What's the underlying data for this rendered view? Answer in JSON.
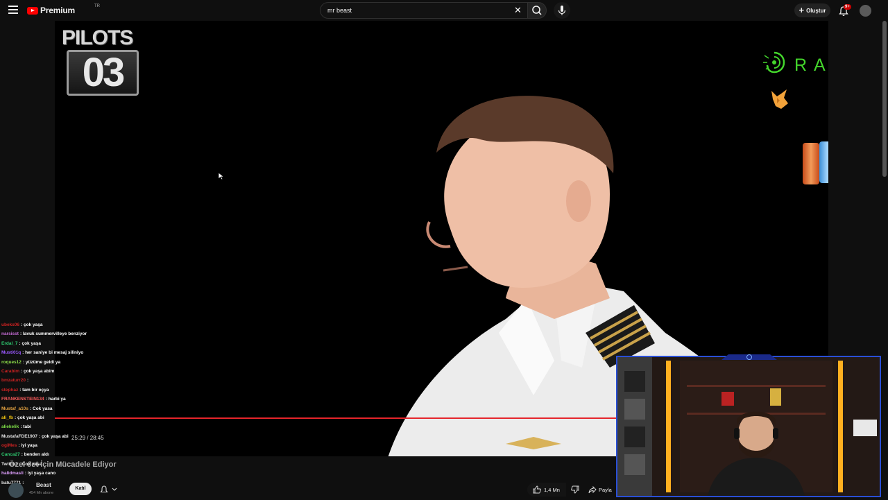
{
  "header": {
    "logo_text": "Premium",
    "logo_sup": "TR",
    "search_value": "mr beast",
    "create_label": "Oluştur",
    "notif_count": "9+"
  },
  "video": {
    "overlay_pilots": "PILOTS",
    "overlay_number": "03",
    "sponsor_text": "RAZER",
    "progress_percent": 90.3,
    "time_display": "25:29 / 28:45",
    "title": "Özel Jet İçin Mücadele Ediyor"
  },
  "chat": [
    {
      "user": "ubeks06",
      "msg": ": çok yaşa",
      "color": "#cc2222"
    },
    {
      "user": "narsisst",
      "msg": ": lavuk summervilleye benziyor",
      "color": "#c86dd7"
    },
    {
      "user": "Erdal_7",
      "msg": ": çok yaşa",
      "color": "#2ecc71"
    },
    {
      "user": "Musti01q",
      "msg": ": her saniye bi mesaj siliniyo",
      "color": "#9b59ff"
    },
    {
      "user": "roques12",
      "msg": ": yüzüme geldi ya",
      "color": "#8fe04a"
    },
    {
      "user": "Carabim",
      "msg": ": çok yaşa abim",
      "color": "#cc2222"
    },
    {
      "user": "bmzaturr20",
      "msg": ":",
      "color": "#cc2222"
    },
    {
      "user": "stephaz",
      "msg": ": tam bir oçya",
      "color": "#cc2222"
    },
    {
      "user": "FRANKENSTEIN134",
      "msg": ": harbi ya",
      "color": "#ff5c5c"
    },
    {
      "user": "Mustaf_a10s",
      "msg": ": Cok yasa",
      "color": "#e0a040"
    },
    {
      "user": "ali_fb",
      "msg": ": çok yaşa abi",
      "color": "#f1c40f"
    },
    {
      "user": "aliekelik",
      "msg": ": tabi",
      "color": "#7fe048"
    },
    {
      "user": "MustafaFDE1907",
      "msg": ": çok yaşa abi",
      "color": "#e0e0e0"
    },
    {
      "user": "ogiMes",
      "msg": ": iyi yaşa",
      "color": "#cc2222"
    },
    {
      "user": "Canca27",
      "msg": ": benden aldı",
      "color": "#2ecc71"
    },
    {
      "user": "Twitch3",
      "msg": ": Çok yaşa",
      "color": "#e0e0e0"
    },
    {
      "user": "halidmasli",
      "msg": ": iyi yaşa cano",
      "color": "#e0a0ff"
    },
    {
      "user": "batu7771",
      "msg": ":",
      "color": "#e0e0e0"
    }
  ],
  "channel": {
    "name": "Beast",
    "subs": "454 Mn abone",
    "join_label": "Katıl"
  },
  "actions": {
    "likes": "1,4 Mn",
    "share_label": "Payla"
  },
  "colors": {
    "progress": "#e5252b",
    "razer_green": "#44d62c",
    "webcam_border": "#2a4fd6"
  }
}
